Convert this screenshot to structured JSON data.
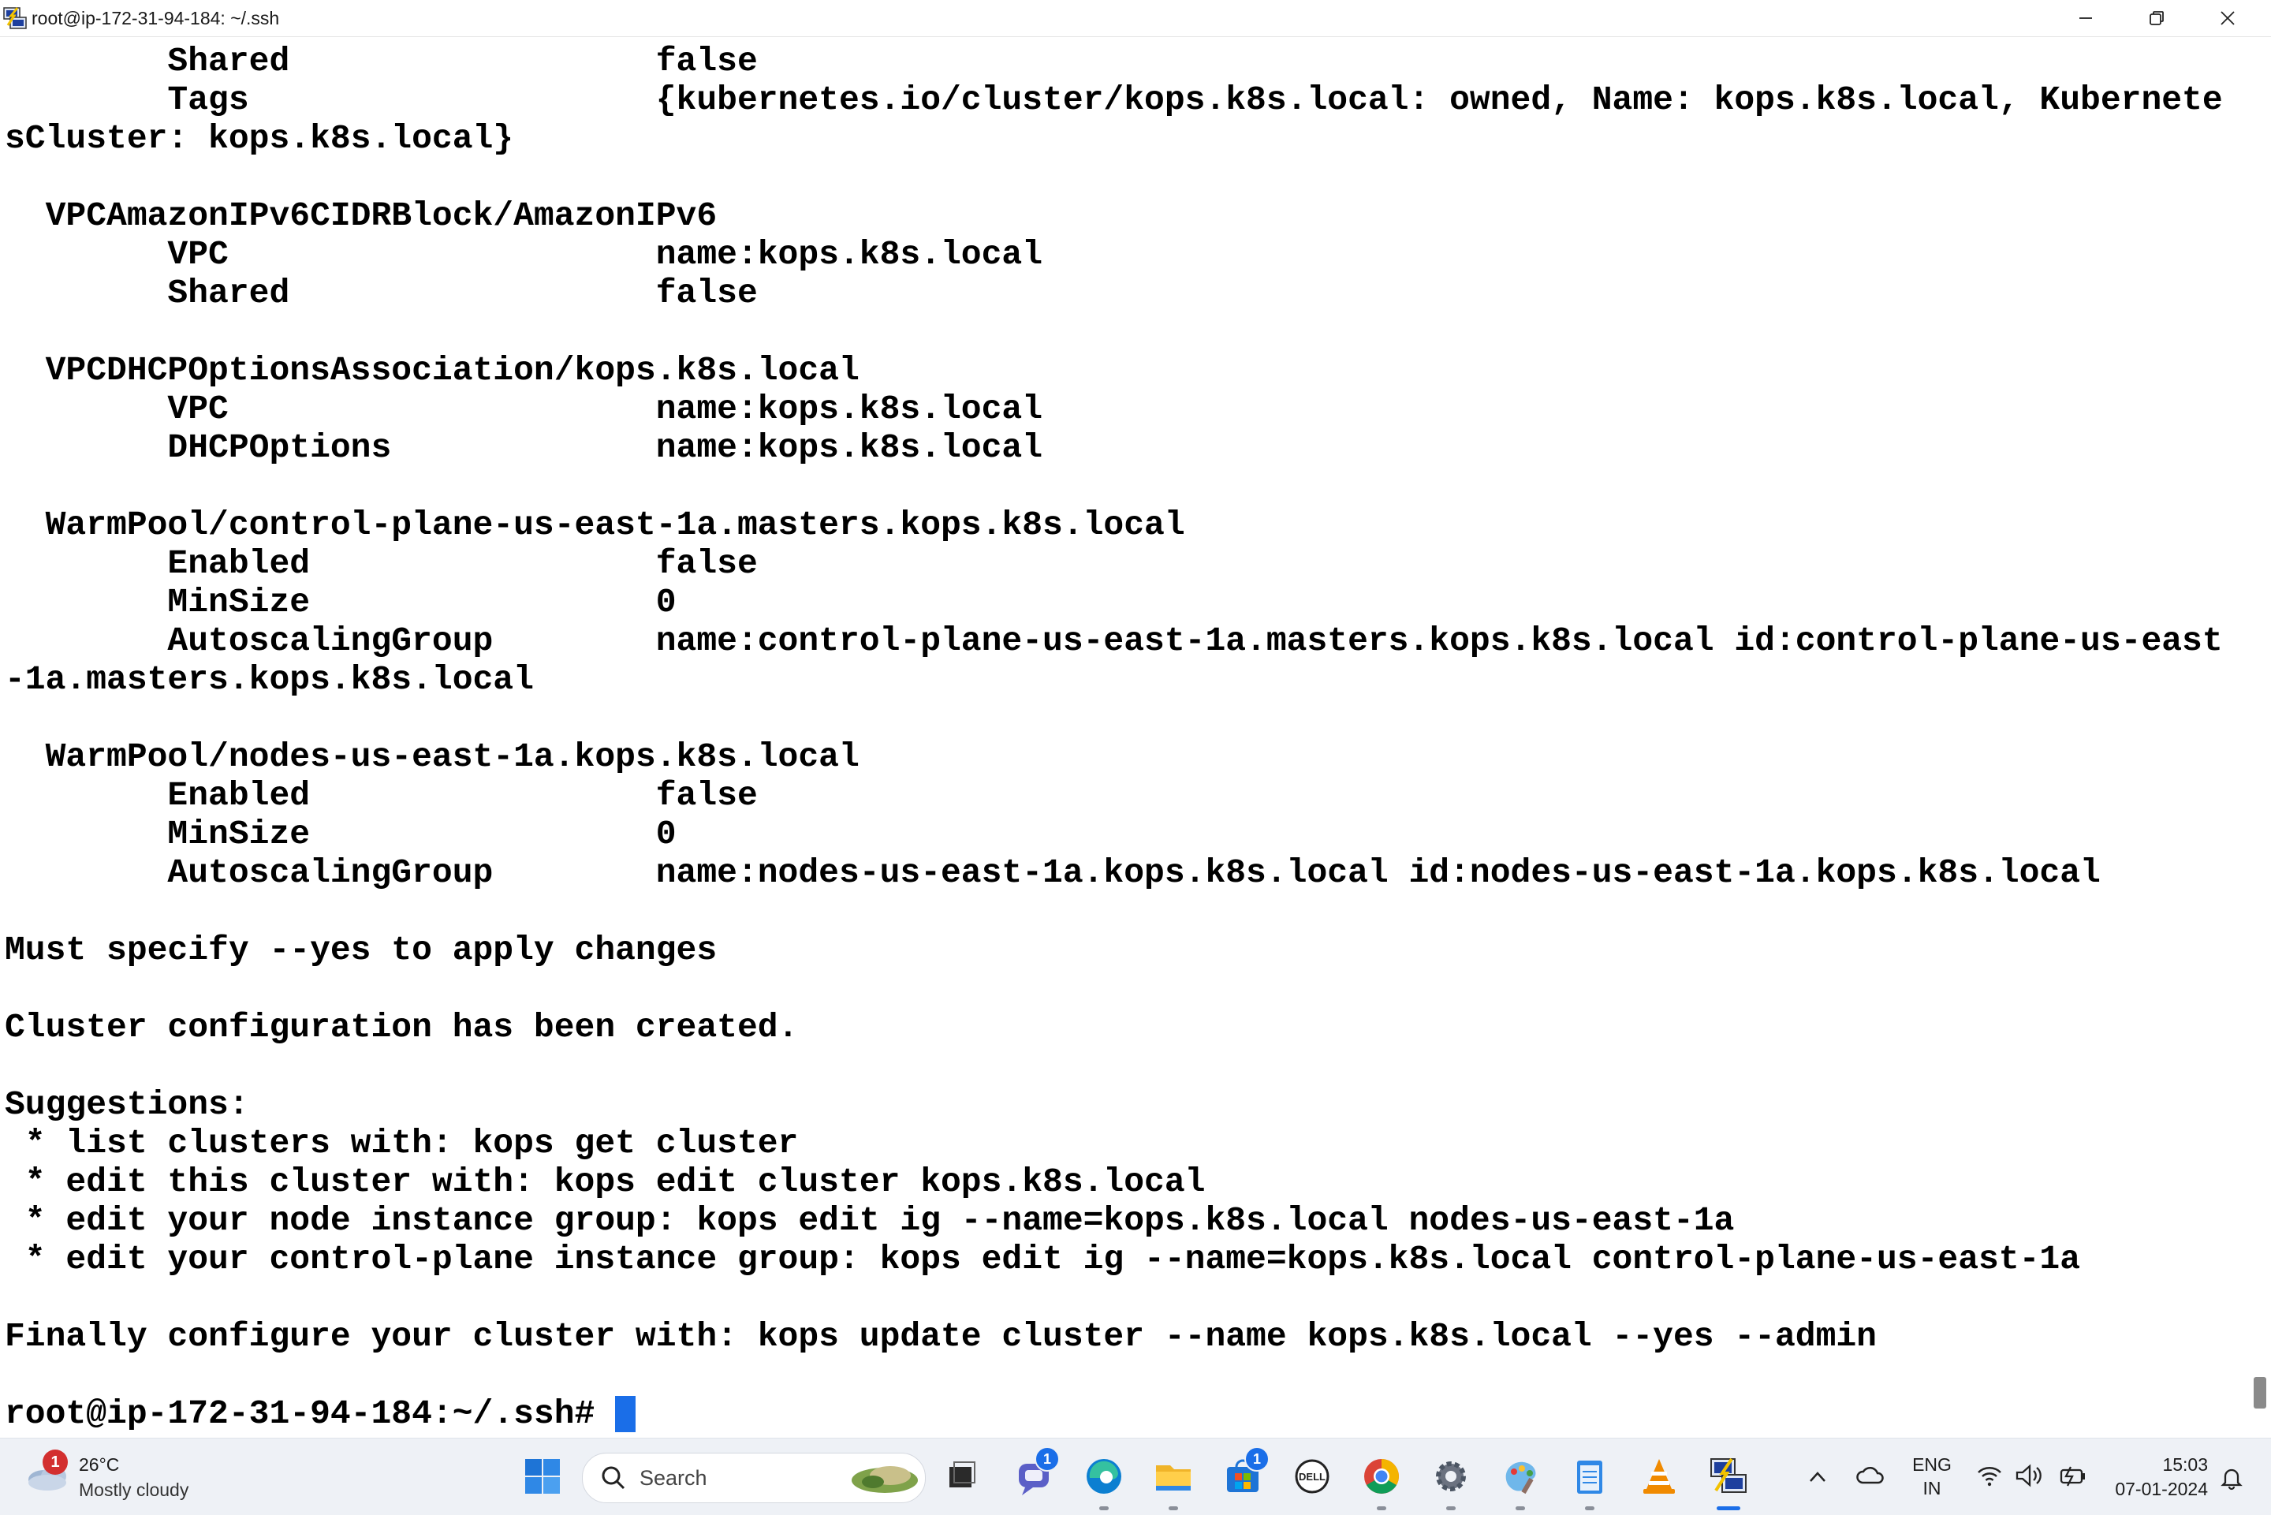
{
  "window": {
    "title": "root@ip-172-31-94-184: ~/.ssh",
    "icon": "putty-icon"
  },
  "terminal": {
    "lines": [
      "        Shared                  false",
      "        Tags                    {kubernetes.io/cluster/kops.k8s.local: owned, Name: kops.k8s.local, Kubernete",
      "sCluster: kops.k8s.local}",
      "",
      "  VPCAmazonIPv6CIDRBlock/AmazonIPv6",
      "        VPC                     name:kops.k8s.local",
      "        Shared                  false",
      "",
      "  VPCDHCPOptionsAssociation/kops.k8s.local",
      "        VPC                     name:kops.k8s.local",
      "        DHCPOptions             name:kops.k8s.local",
      "",
      "  WarmPool/control-plane-us-east-1a.masters.kops.k8s.local",
      "        Enabled                 false",
      "        MinSize                 0",
      "        AutoscalingGroup        name:control-plane-us-east-1a.masters.kops.k8s.local id:control-plane-us-east",
      "-1a.masters.kops.k8s.local",
      "",
      "  WarmPool/nodes-us-east-1a.kops.k8s.local",
      "        Enabled                 false",
      "        MinSize                 0",
      "        AutoscalingGroup        name:nodes-us-east-1a.kops.k8s.local id:nodes-us-east-1a.kops.k8s.local",
      "",
      "Must specify --yes to apply changes",
      "",
      "Cluster configuration has been created.",
      "",
      "Suggestions:",
      " * list clusters with: kops get cluster",
      " * edit this cluster with: kops edit cluster kops.k8s.local",
      " * edit your node instance group: kops edit ig --name=kops.k8s.local nodes-us-east-1a",
      " * edit your control-plane instance group: kops edit ig --name=kops.k8s.local control-plane-us-east-1a",
      "",
      "Finally configure your cluster with: kops update cluster --name kops.k8s.local --yes --admin",
      "",
      "root@ip-172-31-94-184:~/.ssh# "
    ],
    "cursor_color": "#1a6ee8"
  },
  "taskbar": {
    "weather": {
      "temp": "26°C",
      "desc": "Mostly cloudy",
      "badge": "1"
    },
    "search_label": "Search",
    "apps": [
      {
        "name": "start-icon"
      },
      {
        "name": "task-view-icon"
      },
      {
        "name": "teams-chat-icon",
        "badge": "1"
      },
      {
        "name": "edge-icon"
      },
      {
        "name": "file-explorer-icon"
      },
      {
        "name": "microsoft-store-icon",
        "badge": "1"
      },
      {
        "name": "dell-icon"
      },
      {
        "name": "chrome-icon"
      },
      {
        "name": "settings-icon"
      },
      {
        "name": "paint-icon"
      },
      {
        "name": "notepad-icon"
      },
      {
        "name": "vlc-icon"
      },
      {
        "name": "putty-icon"
      }
    ],
    "lang_line1": "ENG",
    "lang_line2": "IN",
    "time": "15:03",
    "date": "07-01-2024"
  },
  "colors": {
    "accent": "#1a6ee8",
    "taskbar_bg": "#eef1f6"
  }
}
